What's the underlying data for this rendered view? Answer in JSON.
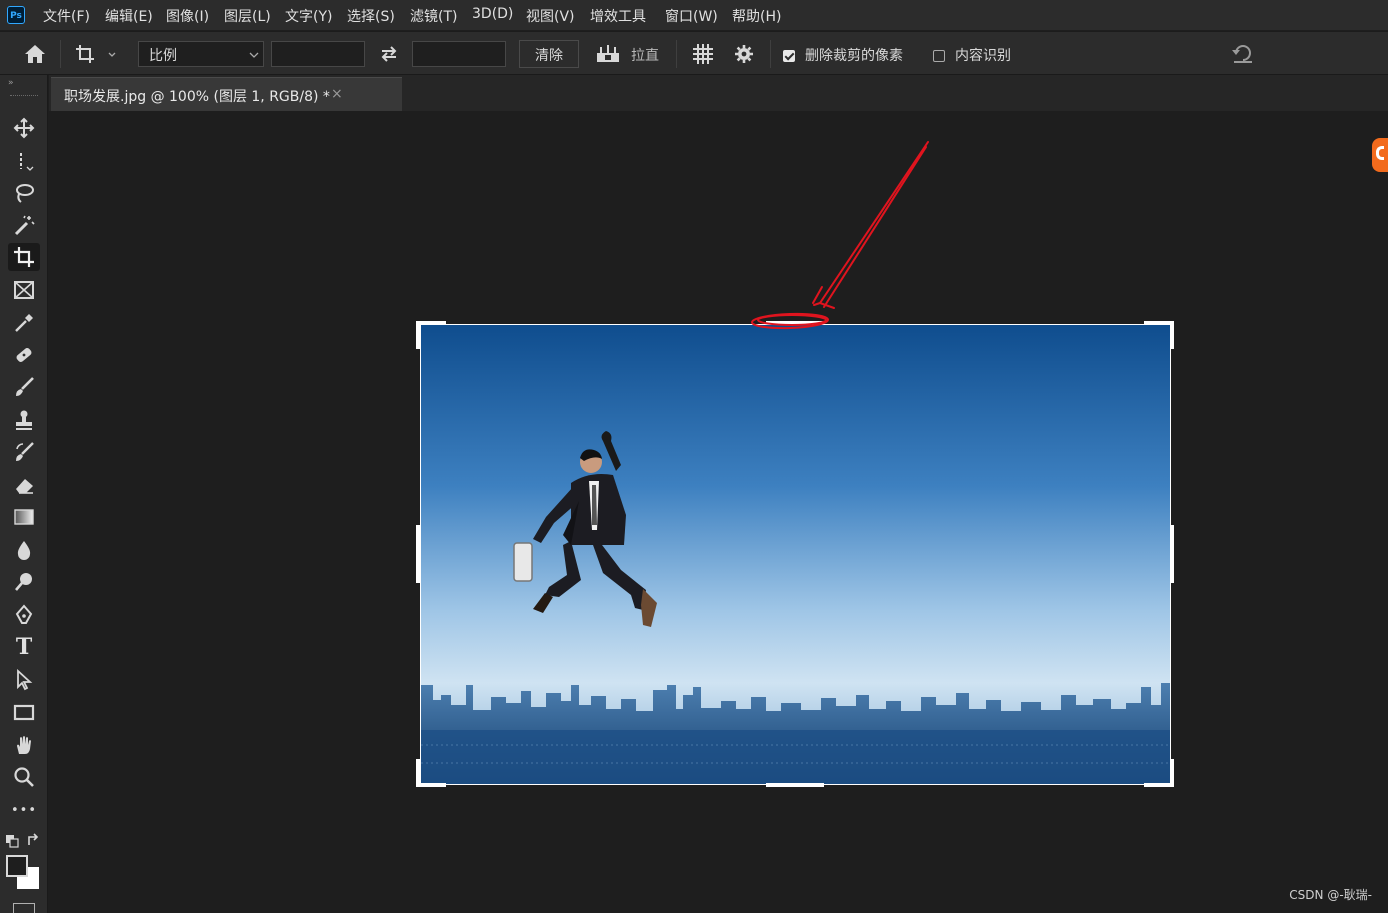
{
  "app": {
    "logo_text": "Ps"
  },
  "menu": [
    "文件(F)",
    "编辑(E)",
    "图像(I)",
    "图层(L)",
    "文字(Y)",
    "选择(S)",
    "滤镜(T)",
    "3D(D)",
    "视图(V)",
    "增效工具",
    "窗口(W)",
    "帮助(H)"
  ],
  "options": {
    "ratio_select": "比例",
    "width_value": "",
    "height_value": "",
    "clear_label": "清除",
    "straighten_label": "拉直",
    "delete_cropped_label": "删除裁剪的像素",
    "delete_cropped_checked": true,
    "content_aware_label": "内容识别",
    "content_aware_checked": false
  },
  "document": {
    "tab_title": "职场发展.jpg @ 100% (图层 1, RGB/8) *",
    "close_glyph": "×"
  },
  "tools": [
    {
      "name": "move-tool-icon",
      "active": false
    },
    {
      "name": "marquee-tool-icon",
      "active": false
    },
    {
      "name": "lasso-tool-icon",
      "active": false
    },
    {
      "name": "magic-wand-tool-icon",
      "active": false
    },
    {
      "name": "crop-tool-icon",
      "active": true
    },
    {
      "name": "frame-tool-icon",
      "active": false
    },
    {
      "name": "eyedropper-tool-icon",
      "active": false
    },
    {
      "name": "healing-brush-tool-icon",
      "active": false
    },
    {
      "name": "brush-tool-icon",
      "active": false
    },
    {
      "name": "clone-stamp-tool-icon",
      "active": false
    },
    {
      "name": "history-brush-tool-icon",
      "active": false
    },
    {
      "name": "eraser-tool-icon",
      "active": false
    },
    {
      "name": "gradient-tool-icon",
      "active": false
    },
    {
      "name": "blur-tool-icon",
      "active": false
    },
    {
      "name": "dodge-tool-icon",
      "active": false
    },
    {
      "name": "pen-tool-icon",
      "active": false
    },
    {
      "name": "type-tool-icon",
      "active": false
    },
    {
      "name": "path-selection-tool-icon",
      "active": false
    },
    {
      "name": "rectangle-tool-icon",
      "active": false
    },
    {
      "name": "hand-tool-icon",
      "active": false
    },
    {
      "name": "zoom-tool-icon",
      "active": false
    },
    {
      "name": "more-tools-icon",
      "active": false
    }
  ],
  "type_tool_glyph": "T",
  "more_tools_glyph": "•••",
  "annotation": {
    "color": "#e0141e"
  },
  "watermark": "CSDN @-耿瑞-",
  "colors": {
    "foreground": "#1e1e1e",
    "background": "#ffffff",
    "accent": "#31a8ff"
  }
}
